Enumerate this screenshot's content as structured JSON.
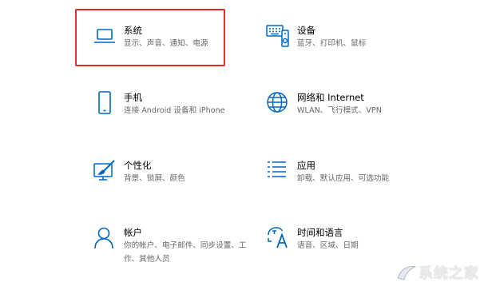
{
  "accent": "#0067c0",
  "highlight_color": "#e4282b",
  "tiles": [
    {
      "icon": "laptop-icon",
      "title": "系统",
      "desc": "显示、声音、通知、电源"
    },
    {
      "icon": "keyboard-device-icon",
      "title": "设备",
      "desc": "蓝牙、打印机、鼠标"
    },
    {
      "icon": "phone-icon",
      "title": "手机",
      "desc": "连接 Android 设备和 iPhone"
    },
    {
      "icon": "globe-icon",
      "title": "网络和 Internet",
      "desc": "WLAN、飞行模式、VPN"
    },
    {
      "icon": "paint-brush-icon",
      "title": "个性化",
      "desc": "背景、锁屏、颜色"
    },
    {
      "icon": "apps-list-icon",
      "title": "应用",
      "desc": "卸载、默认应用、可选功能"
    },
    {
      "icon": "person-icon",
      "title": "帐户",
      "desc": "你的帐户、电子邮件、同步设置、工作、其他人员"
    },
    {
      "icon": "language-icon",
      "title": "时间和语言",
      "desc": "语音、区域、日期"
    }
  ]
}
